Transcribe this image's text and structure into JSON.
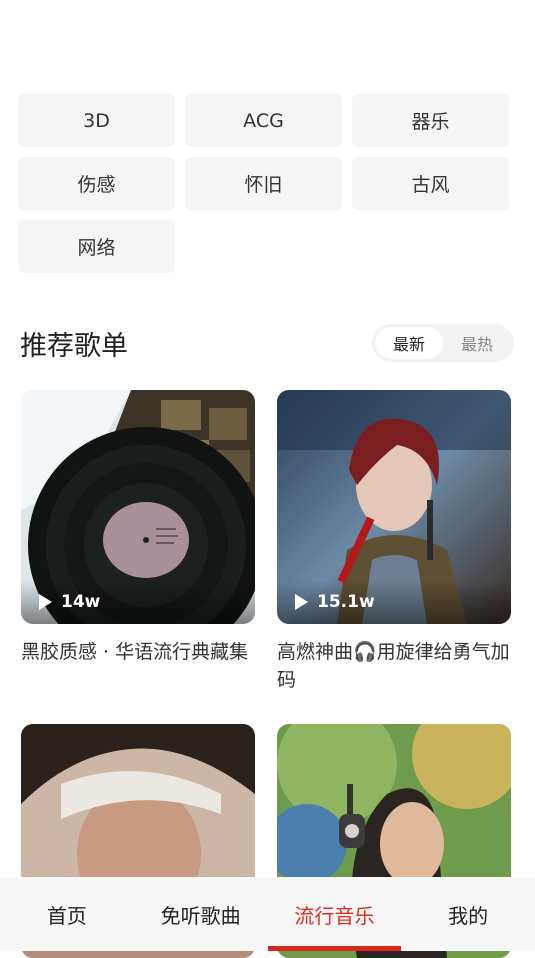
{
  "tags": [
    "3D",
    "ACG",
    "器乐",
    "伤感",
    "怀旧",
    "古风",
    "网络"
  ],
  "section": {
    "title": "推荐歌单",
    "sort_options": [
      "最新",
      "最热"
    ],
    "selected_sort": "最新"
  },
  "playlists": [
    {
      "play_count": "14w",
      "title": "黑胶质感 · 华语流行典藏集"
    },
    {
      "play_count": "15.1w",
      "title": "高燃神曲🎧用旋律给勇气加码"
    },
    {
      "play_count": "",
      "title": ""
    },
    {
      "play_count": "",
      "title": ""
    }
  ],
  "tabbar": {
    "items": [
      "首页",
      "免听歌曲",
      "流行音乐",
      "我的"
    ],
    "active": "流行音乐"
  },
  "colors": {
    "accent": "#e02e1f",
    "tag_bg": "#f5f5f5",
    "tabbar_bg": "#f7f7f7"
  },
  "icons": {
    "play": "play-icon"
  }
}
